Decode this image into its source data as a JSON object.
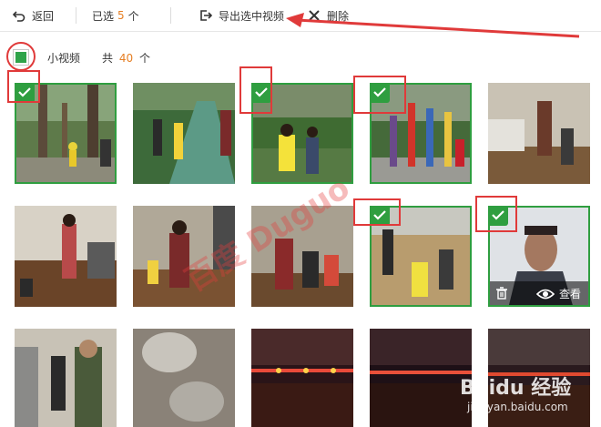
{
  "toolbar": {
    "back_label": "返回",
    "selected_prefix": "已选",
    "selected_count": "5",
    "selected_suffix": "个",
    "export_label": "导出选中视频",
    "delete_label": "删除"
  },
  "subbar": {
    "category_label": "小视频",
    "total_prefix": "共",
    "total_count": "40",
    "total_suffix": "个"
  },
  "hover_actions": {
    "view_label": "查看"
  },
  "watermark": {
    "text": "百度 Duguo",
    "logo_text": "Baidu 经验",
    "url_text": "jingyan.baidu.com"
  },
  "colors": {
    "accent_green": "#2f9e40",
    "count_orange": "#e67e22",
    "annotation_red": "#e03a3a"
  },
  "grid": {
    "thumbnails": [
      {
        "selected": true,
        "scene": "park-trees"
      },
      {
        "selected": false,
        "scene": "park-path"
      },
      {
        "selected": true,
        "scene": "garden-kids"
      },
      {
        "selected": true,
        "scene": "sculpture"
      },
      {
        "selected": false,
        "scene": "living-room"
      },
      {
        "selected": false,
        "scene": "indoor-girl"
      },
      {
        "selected": false,
        "scene": "indoor-dance"
      },
      {
        "selected": false,
        "scene": "indoor-group"
      },
      {
        "selected": true,
        "scene": "beach-kids"
      },
      {
        "selected": true,
        "scene": "man-portrait"
      },
      {
        "selected": false,
        "scene": "indoor-adults"
      },
      {
        "selected": false,
        "scene": "blurry-coins"
      },
      {
        "selected": false,
        "scene": "night-lights"
      },
      {
        "selected": false,
        "scene": "night-lights-2"
      },
      {
        "selected": false,
        "scene": "night-street"
      }
    ]
  }
}
